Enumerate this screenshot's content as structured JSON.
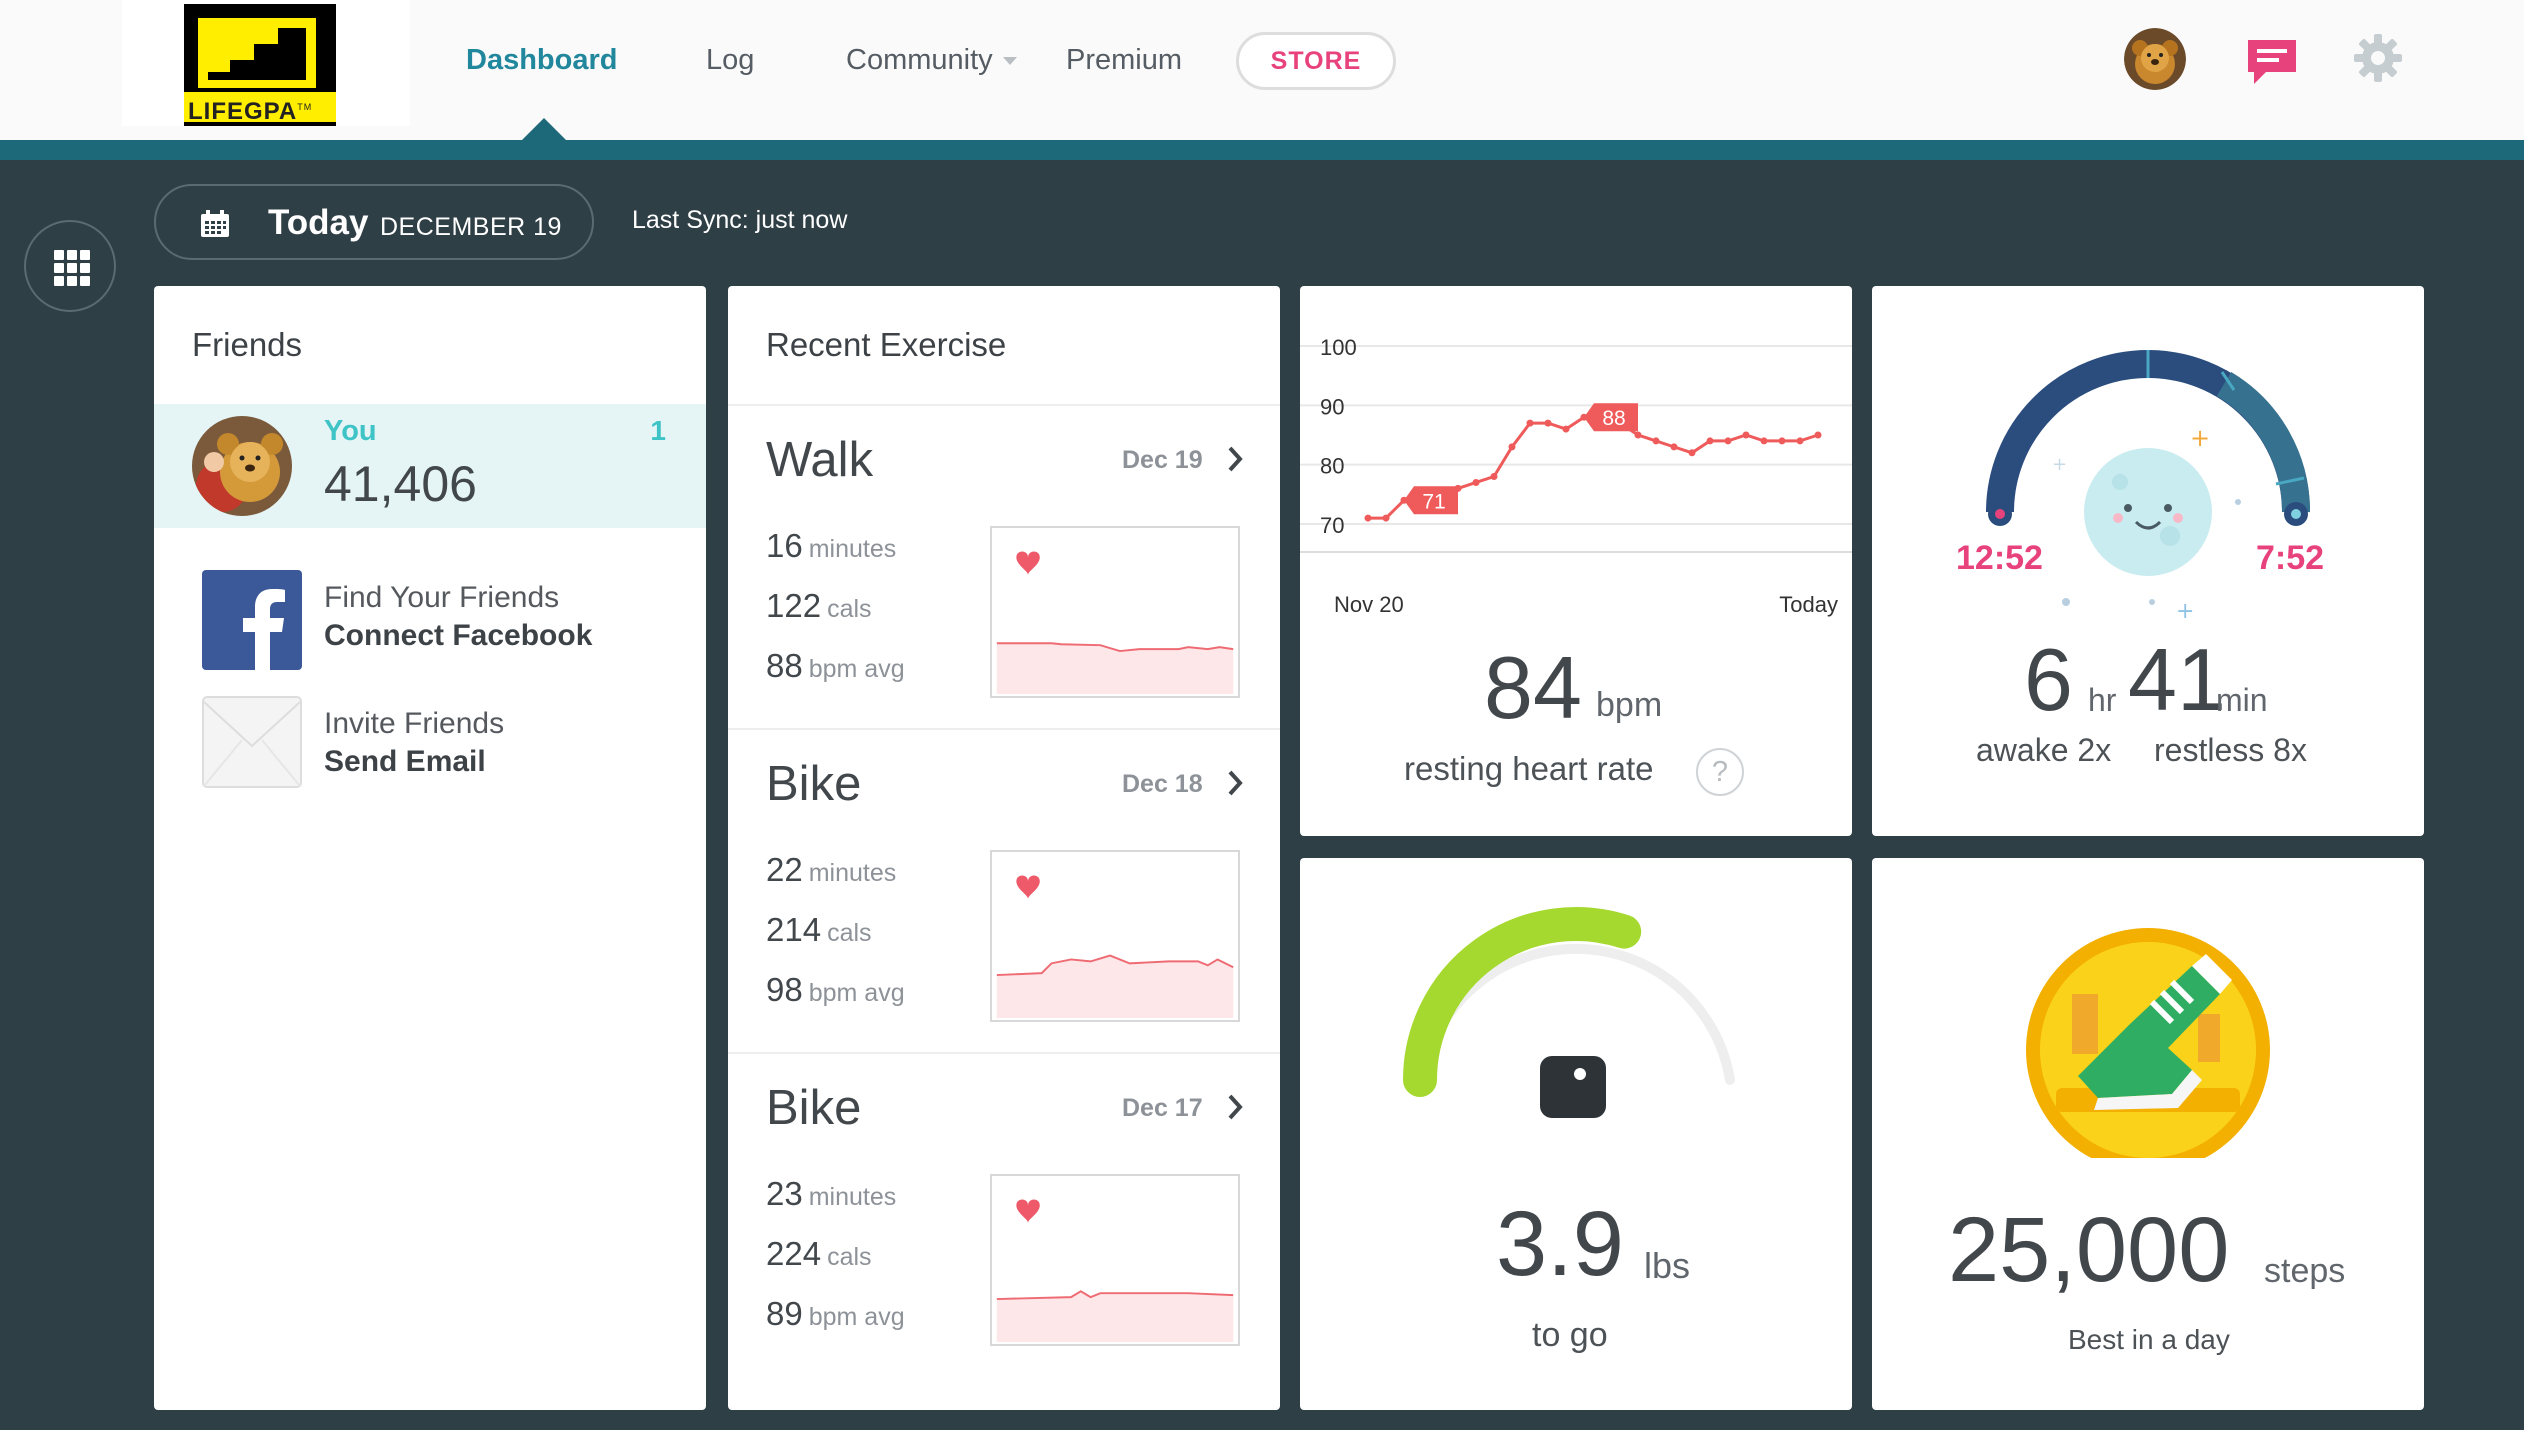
{
  "header": {
    "logo_text": "LIFEGPA",
    "logo_tm": "TM",
    "nav": {
      "dashboard": "Dashboard",
      "log": "Log",
      "community": "Community",
      "premium": "Premium"
    },
    "store_label": "STORE",
    "icons": {
      "avatar": "avatar",
      "messages": "chat-bubble-icon",
      "settings": "gear-icon"
    },
    "colors": {
      "active_nav": "#21879c",
      "store": "#e8427d",
      "strip": "#1d6979"
    }
  },
  "subbar": {
    "today": "Today",
    "date": "DECEMBER 19",
    "last_sync": "Last Sync: just now"
  },
  "friends": {
    "title": "Friends",
    "you": {
      "name": "You",
      "rank": "1",
      "steps": "41,406"
    },
    "find": {
      "line1": "Find Your Friends",
      "line2": "Connect Facebook"
    },
    "invite": {
      "line1": "Invite Friends",
      "line2": "Send Email"
    }
  },
  "exercise": {
    "title": "Recent Exercise",
    "items": [
      {
        "name": "Walk",
        "date": "Dec 19",
        "minutes": "16",
        "minutes_unit": "minutes",
        "cals": "122",
        "cals_unit": "cals",
        "bpm": "88",
        "bpm_unit": "bpm avg"
      },
      {
        "name": "Bike",
        "date": "Dec 18",
        "minutes": "22",
        "minutes_unit": "minutes",
        "cals": "214",
        "cals_unit": "cals",
        "bpm": "98",
        "bpm_unit": "bpm avg"
      },
      {
        "name": "Bike",
        "date": "Dec 17",
        "minutes": "23",
        "minutes_unit": "minutes",
        "cals": "224",
        "cals_unit": "cals",
        "bpm": "89",
        "bpm_unit": "bpm avg"
      }
    ]
  },
  "heart": {
    "value": "84",
    "unit": "bpm",
    "caption": "resting heart rate",
    "help": "?",
    "x_start": "Nov 20",
    "x_end": "Today",
    "yticks": [
      "100",
      "90",
      "80",
      "70"
    ],
    "min_label": "71",
    "max_label": "88"
  },
  "sleep": {
    "start": "12:52",
    "end": "7:52",
    "hours": "6",
    "hours_unit": "hr",
    "minutes": "41",
    "minutes_unit": "min",
    "awake": "awake 2x",
    "restless": "restless 8x"
  },
  "weight": {
    "value": "3.9",
    "unit": "lbs",
    "caption": "to go",
    "progress": 0.6
  },
  "steps_badge": {
    "value": "25,000",
    "unit": "steps",
    "caption": "Best in a day"
  },
  "chart_data": {
    "type": "line",
    "series": [
      {
        "values": [
          71,
          71,
          74,
          74,
          75,
          76,
          77,
          78,
          83,
          87,
          87,
          86,
          88,
          87,
          87,
          85,
          84,
          83,
          82,
          84,
          84,
          85,
          84,
          84,
          84,
          85
        ]
      }
    ],
    "ylim": [
      70,
      100
    ],
    "xlabel": "",
    "ylabel": "",
    "grid": true
  }
}
